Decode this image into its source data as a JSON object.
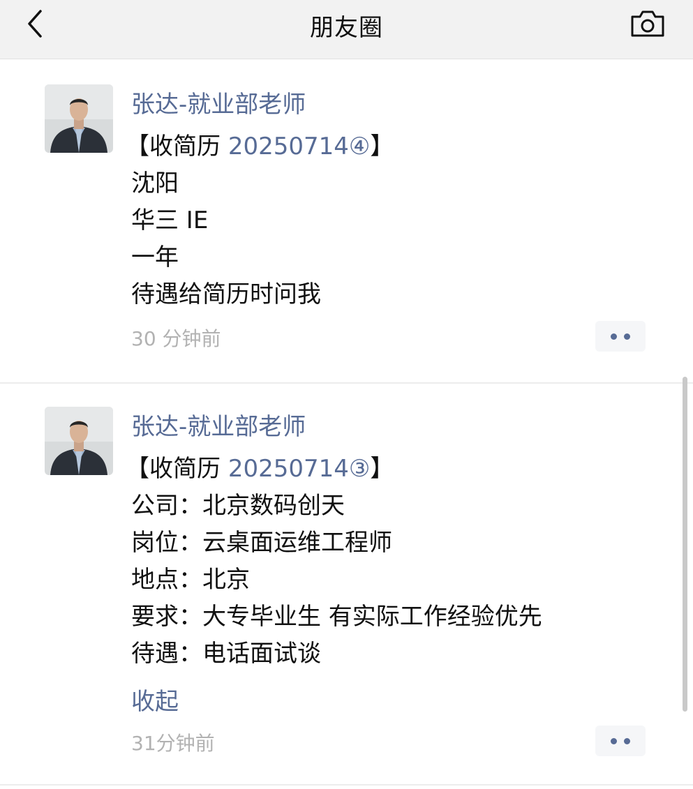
{
  "header": {
    "title": "朋友圈",
    "back_icon": "chevron-left-icon",
    "camera_icon": "camera-icon"
  },
  "posts": [
    {
      "author": "张达-就业部老师",
      "content": {
        "prefix": "【收简历 ",
        "code": "20250714④",
        "suffix": "】",
        "lines": [
          "沈阳",
          "华三 IE",
          "一年",
          "待遇给简历时问我"
        ]
      },
      "time": "30 分钟前"
    },
    {
      "author": "张达-就业部老师",
      "content": {
        "prefix": "【收简历 ",
        "code": "20250714③",
        "suffix": "】",
        "lines": [
          "公司：北京数码创天",
          "岗位：云桌面运维工程师",
          "地点：北京",
          "要求：大专毕业生 有实际工作经验优先",
          "待遇：电话面试谈"
        ]
      },
      "collapse_label": "收起",
      "time": "31分钟前"
    }
  ],
  "colors": {
    "link": "#576b95",
    "text": "#111111",
    "timestamp": "#b2b2b2",
    "header_bg": "#f2f2f2"
  }
}
